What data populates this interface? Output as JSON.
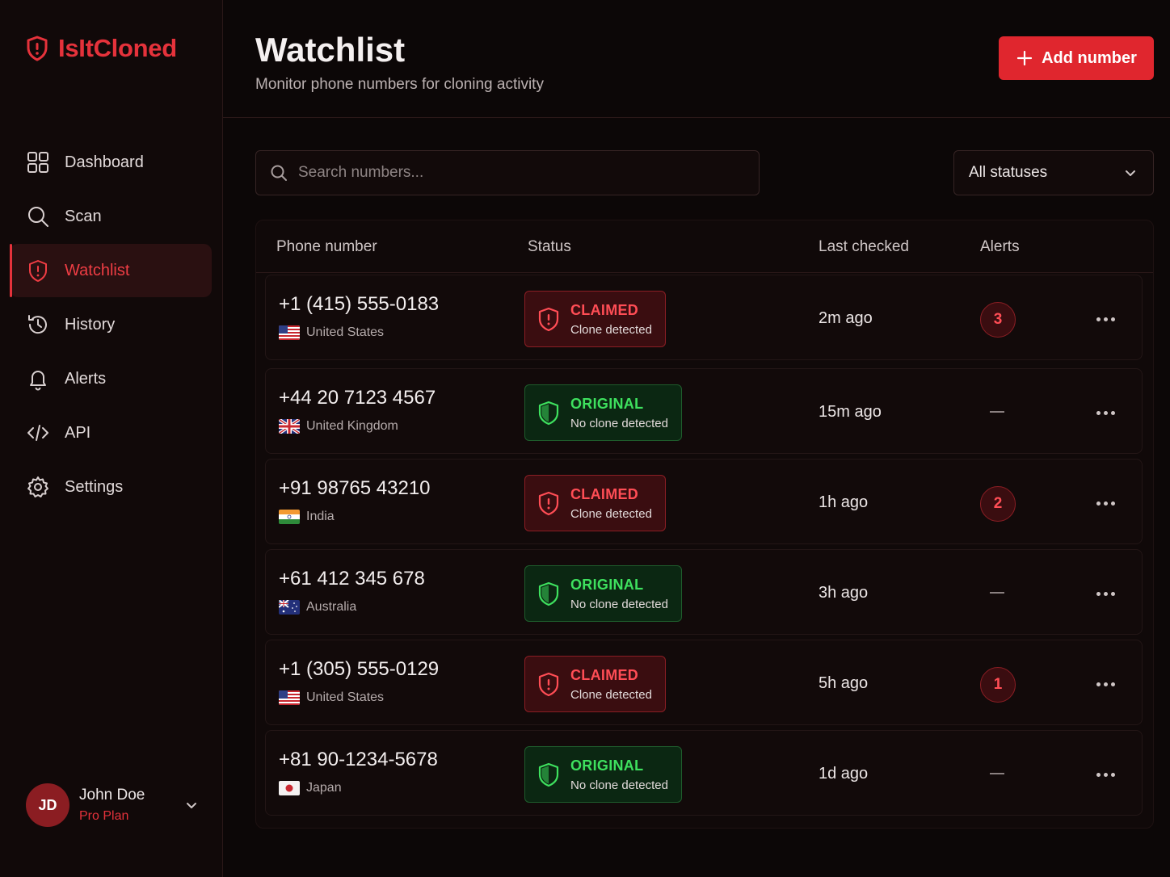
{
  "brand": {
    "name": "IsItCloned",
    "accent": "#e5323b"
  },
  "sidebar": {
    "items": [
      {
        "id": "dashboard",
        "label": "Dashboard",
        "icon": "grid-icon",
        "active": false
      },
      {
        "id": "scan",
        "label": "Scan",
        "icon": "search-icon",
        "active": false
      },
      {
        "id": "watchlist",
        "label": "Watchlist",
        "icon": "shield-icon",
        "active": true
      },
      {
        "id": "history",
        "label": "History",
        "icon": "history-icon",
        "active": false
      },
      {
        "id": "alerts",
        "label": "Alerts",
        "icon": "bell-icon",
        "active": false
      },
      {
        "id": "api",
        "label": "API",
        "icon": "code-icon",
        "active": false
      },
      {
        "id": "settings",
        "label": "Settings",
        "icon": "gear-icon",
        "active": false
      }
    ]
  },
  "user": {
    "initials": "JD",
    "name": "John Doe",
    "plan": "Pro Plan"
  },
  "header": {
    "title": "Watchlist",
    "subtitle": "Monitor phone numbers for cloning activity",
    "add_button_label": "Add number"
  },
  "search": {
    "placeholder": "Search numbers..."
  },
  "filter": {
    "selected": "All statuses"
  },
  "table": {
    "columns": {
      "phone": "Phone number",
      "status": "Status",
      "last_checked": "Last checked",
      "alerts": "Alerts"
    },
    "rows": [
      {
        "phone": "+1 (415) 555-0183",
        "country": "United States",
        "flag": "us",
        "status": "claimed",
        "status_title": "CLAIMED",
        "status_sub": "Clone detected",
        "last_checked": "2m ago",
        "alerts": "3"
      },
      {
        "phone": "+44 20 7123 4567",
        "country": "United Kingdom",
        "flag": "gb",
        "status": "original",
        "status_title": "ORIGINAL",
        "status_sub": "No clone detected",
        "last_checked": "15m ago",
        "alerts": null
      },
      {
        "phone": "+91 98765 43210",
        "country": "India",
        "flag": "in",
        "status": "claimed",
        "status_title": "CLAIMED",
        "status_sub": "Clone detected",
        "last_checked": "1h ago",
        "alerts": "2"
      },
      {
        "phone": "+61 412 345 678",
        "country": "Australia",
        "flag": "au",
        "status": "original",
        "status_title": "ORIGINAL",
        "status_sub": "No clone detected",
        "last_checked": "3h ago",
        "alerts": null
      },
      {
        "phone": "+1 (305) 555-0129",
        "country": "United States",
        "flag": "us",
        "status": "claimed",
        "status_title": "CLAIMED",
        "status_sub": "Clone detected",
        "last_checked": "5h ago",
        "alerts": "1"
      },
      {
        "phone": "+81 90-1234-5678",
        "country": "Japan",
        "flag": "jp",
        "status": "original",
        "status_title": "ORIGINAL",
        "status_sub": "No clone detected",
        "last_checked": "1d ago",
        "alerts": null
      }
    ]
  },
  "colors": {
    "claimed": "#ff4d55",
    "original": "#3ee05e",
    "button": "#e0262e"
  }
}
